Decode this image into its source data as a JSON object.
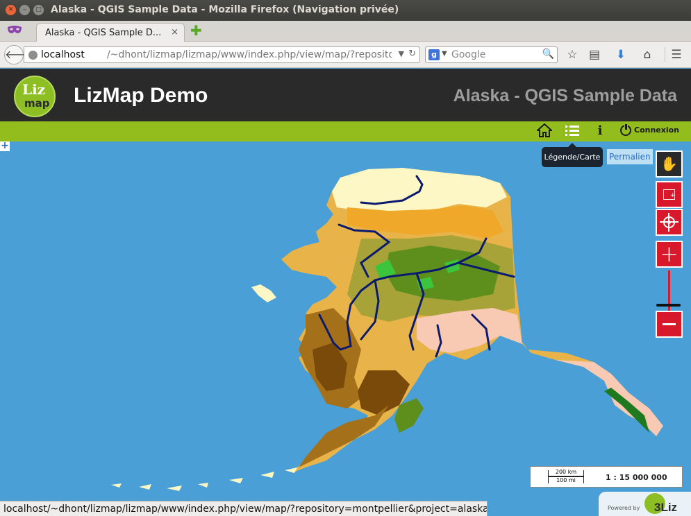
{
  "window": {
    "title": "Alaska - QGIS Sample Data - Mozilla Firefox (Navigation privée)"
  },
  "tab": {
    "title": "Alaska - QGIS Sample D...",
    "close": "×"
  },
  "newtab": "✚",
  "nav": {
    "url_host": "localhost",
    "url_rest": "/~dhont/lizmap/lizmap/www/index.php/view/map/?repository=m",
    "search_placeholder": "Google"
  },
  "header": {
    "logo_top": "Liz",
    "logo_bottom": "map",
    "title": "LizMap Demo",
    "project": "Alaska - QGIS Sample Data"
  },
  "menu": {
    "connexion": "Connexion"
  },
  "map": {
    "tooltip": "Légende/Carte",
    "permalink": "Permalien",
    "expand": "+",
    "scale_km": "200 km",
    "scale_mi": "100 mi",
    "scale_value": "1 : 15 000 000",
    "powered_label": "Powered by",
    "powered_name": "3Liz"
  },
  "status": {
    "text": "localhost/~dhont/lizmap/lizmap/www/index.php/view/map/?repository=montpellier&project=alaska#"
  },
  "colors": {
    "map_water": "#4a9fd6",
    "menubar_green": "#93bd1d",
    "header_dark": "#2a2a2a",
    "tool_red": "#d7192b",
    "river_navy": "#0b1a6e"
  }
}
